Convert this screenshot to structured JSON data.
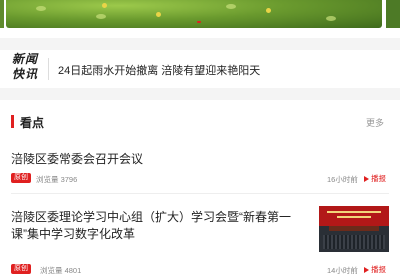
{
  "banner": {
    "image": "green-field-photo"
  },
  "flash": {
    "logo_line1": "新闻",
    "logo_line2": "快讯",
    "headline": "24日起雨水开始撤离 涪陵有望迎来艳阳天"
  },
  "section": {
    "title": "看点",
    "more": "更多"
  },
  "news": [
    {
      "title": "涪陵区委常委会召开会议",
      "tag": "原创",
      "views": "浏览量 3796",
      "time": "16小时前",
      "play": "播报"
    },
    {
      "title": "涪陵区委理论学习中心组（扩大）学习会暨“新春第一课”集中学习数字化改革",
      "tag": "原创",
      "views": "浏览量 4801",
      "time": "14小时前",
      "play": "播报",
      "thumbnail": "meeting-hall-photo"
    }
  ],
  "colors": {
    "accent": "#e02020",
    "text": "#222222",
    "muted": "#888888"
  }
}
